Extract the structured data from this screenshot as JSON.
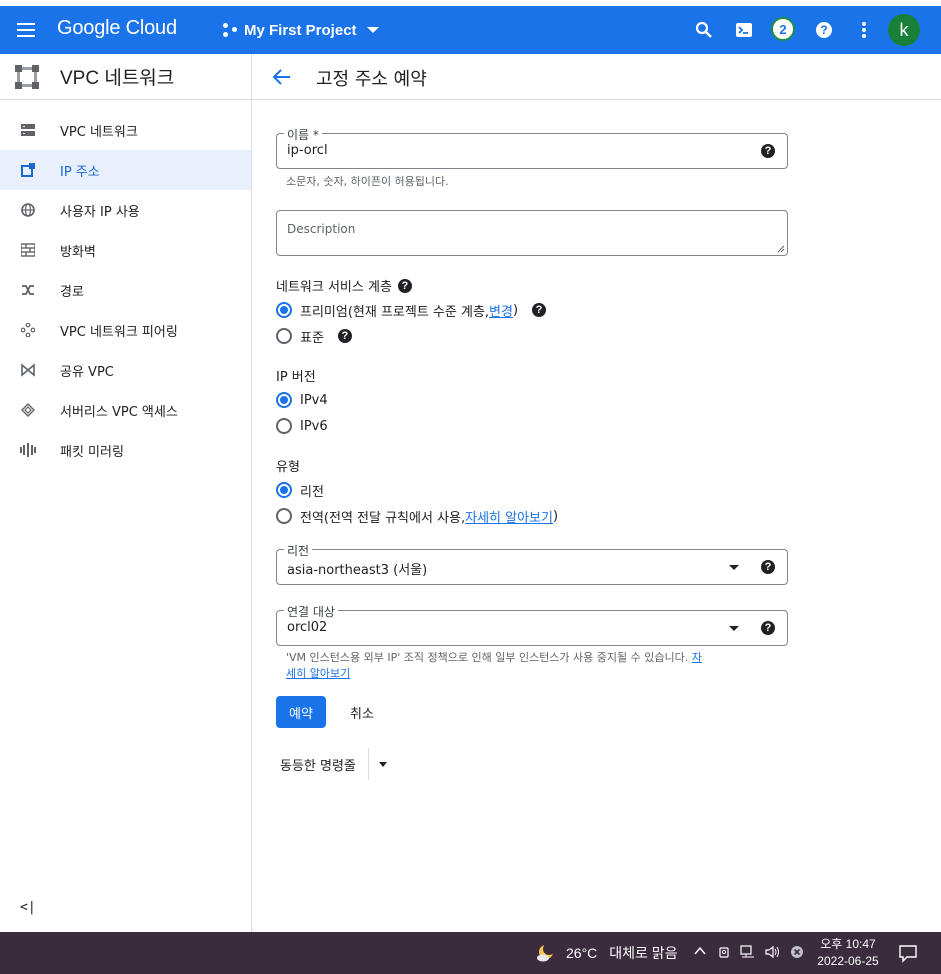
{
  "appbar": {
    "logo": "Google Cloud",
    "project": "My First Project",
    "notification_count": "2",
    "avatar_letter": "k",
    "help_symbol": "?"
  },
  "sidebar": {
    "title": "VPC 네트워크",
    "items": [
      {
        "label": "VPC 네트워크",
        "icon": "vpc-network-icon",
        "active": false
      },
      {
        "label": "IP 주소",
        "icon": "ip-address-icon",
        "active": true
      },
      {
        "label": "사용자 IP 사용",
        "icon": "globe-icon",
        "active": false
      },
      {
        "label": "방화벽",
        "icon": "firewall-icon",
        "active": false
      },
      {
        "label": "경로",
        "icon": "routes-icon",
        "active": false
      },
      {
        "label": "VPC 네트워크 피어링",
        "icon": "peering-icon",
        "active": false
      },
      {
        "label": "공유 VPC",
        "icon": "shared-vpc-icon",
        "active": false
      },
      {
        "label": "서버리스 VPC 액세스",
        "icon": "serverless-icon",
        "active": false
      },
      {
        "label": "패킷 미러링",
        "icon": "packet-mirroring-icon",
        "active": false
      }
    ],
    "collapse_label": "<|"
  },
  "page": {
    "title": "고정 주소 예약"
  },
  "form": {
    "name_label": "이름 *",
    "name_value": "ip-orcl",
    "name_hint": "소문자, 숫자, 하이픈이 허용됩니다.",
    "description_placeholder": "Description",
    "tier_label": "네트워크 서비스 계층",
    "tier_premium_prefix": "프리미엄(현재 프로젝트 수준 계층, ",
    "tier_premium_link": "변경",
    "tier_premium_suffix": ")",
    "tier_standard": "표준",
    "ip_version_label": "IP 버전",
    "ipv4": "IPv4",
    "ipv6": "IPv6",
    "type_label": "유형",
    "type_regional": "리전",
    "type_global_prefix": "전역(전역 전달 규칙에서 사용, ",
    "type_global_link": "자세히 알아보기",
    "type_global_suffix": ")",
    "region_label": "리전",
    "region_value": "asia-northeast3 (서울)",
    "attach_label": "연결 대상",
    "attach_value": "orcl02",
    "attach_hint_prefix": "'VM 인스턴스용 외부 IP' 조직 정책으로 인해 일부 인스턴스가 사용 중지될 수 있습니다. ",
    "attach_hint_link_1": "자",
    "attach_hint_link_2": "세히 알아보기",
    "reserve_button": "예약",
    "cancel_button": "취소",
    "equivalent_command": "동등한 명령줄"
  },
  "taskbar": {
    "temperature": "26°C",
    "weather": "대체로 맑음",
    "time_period": "오후 10:47",
    "date": "2022-06-25"
  },
  "colors": {
    "brand": "#1a73e8",
    "active_bg": "#e8f0fe",
    "taskbar": "#3a2b3d"
  }
}
